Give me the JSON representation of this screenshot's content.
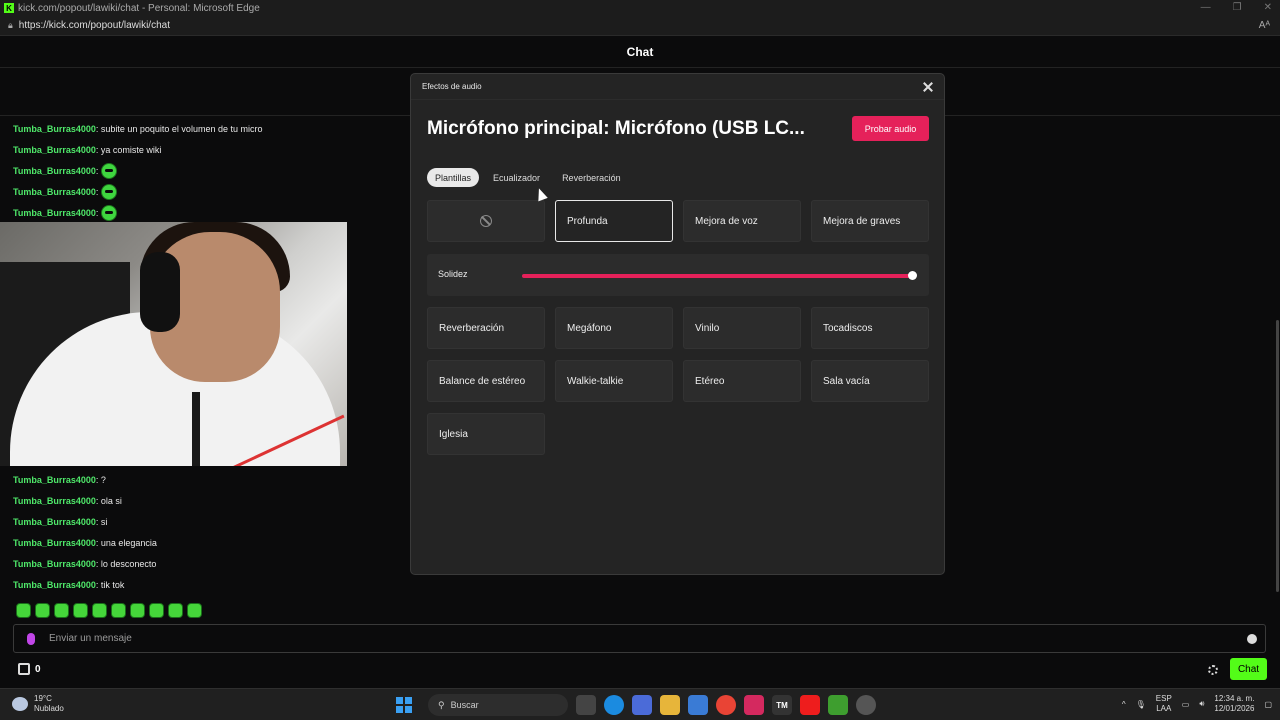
{
  "browser": {
    "title": "kick.com/popout/lawiki/chat - Personal: Microsoft Edge",
    "url": "https://kick.com/popout/lawiki/chat",
    "reader_label": "Aᴬ"
  },
  "chat": {
    "header": "Chat",
    "messages_top": [
      {
        "user": "Tumba_Burras4000",
        "text": ": subite un poquito el volumen de tu micro"
      },
      {
        "user": "Tumba_Burras4000",
        "text": ": ya comiste wiki"
      },
      {
        "user": "Tumba_Burras4000",
        "text": ":"
      },
      {
        "user": "Tumba_Burras4000",
        "text": ":"
      },
      {
        "user": "Tumba_Burras4000",
        "text": ":"
      }
    ],
    "messages_bottom": [
      {
        "user": "Tumba_Burras4000",
        "text": ": ?"
      },
      {
        "user": "Tumba_Burras4000",
        "text": ": ola si"
      },
      {
        "user": "Tumba_Burras4000",
        "text": ": si"
      },
      {
        "user": "Tumba_Burras4000",
        "text": ": una elegancia"
      },
      {
        "user": "Tumba_Burras4000",
        "text": ": lo desconecto"
      },
      {
        "user": "Tumba_Burras4000",
        "text": ": tik tok"
      }
    ],
    "input_placeholder": "Enviar un mensaje",
    "coins": "0",
    "send_label": "Chat"
  },
  "modal": {
    "heading": "Efectos de audio",
    "mic_title": "Micrófono principal: Micrófono (USB LC...",
    "test_button": "Probar audio",
    "tabs": [
      "Plantillas",
      "Ecualizador",
      "Reverberación"
    ],
    "active_tab": 0,
    "presets_row1": [
      "",
      "Profunda",
      "Mejora de voz",
      "Mejora de graves"
    ],
    "selected_preset": 1,
    "slider_label": "Solidez",
    "slider_value": 1.0,
    "presets_more": [
      "Reverberación",
      "Megáfono",
      "Vinilo",
      "Tocadiscos",
      "Balance de estéreo",
      "Walkie-talkie",
      "Etéreo",
      "Sala vacía",
      "Iglesia"
    ],
    "accent_color": "#e5215a"
  },
  "taskbar": {
    "temp": "19°C",
    "weather": "Nublado",
    "search": "Buscar",
    "lang1": "ESP",
    "lang2": "LAA",
    "time": "12:34 a. m.",
    "date": "12/01/2026",
    "weather_badge": "3"
  }
}
